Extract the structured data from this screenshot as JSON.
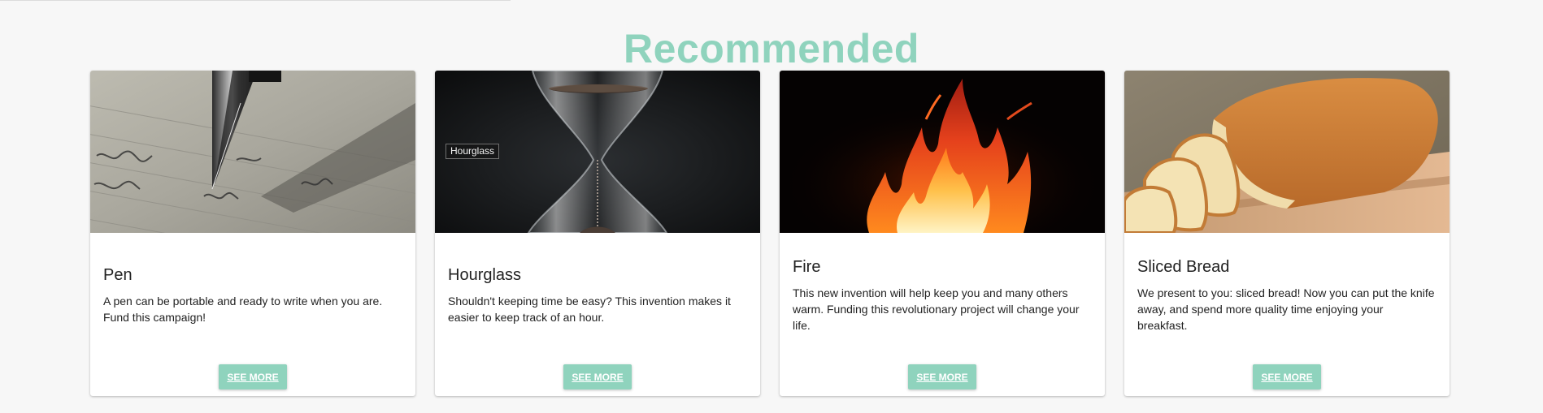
{
  "page": {
    "title": "Recommended",
    "accent_color": "#8fd3bd"
  },
  "cards": [
    {
      "title": "Pen",
      "description": "A pen can be portable and ready to write when you are. Fund this campaign!",
      "button_label": "SEE MORE",
      "image": "pen-writing-image"
    },
    {
      "title": "Hourglass",
      "description": "Shouldn't keeping time be easy? This invention makes it easier to keep track of an hour.",
      "button_label": "SEE MORE",
      "image": "hourglass-image",
      "image_label": "Hourglass"
    },
    {
      "title": "Fire",
      "description": "This new invention will help keep you and many others warm. Funding this revolutionary project will change your life.",
      "button_label": "SEE MORE",
      "image": "fire-image"
    },
    {
      "title": "Sliced Bread",
      "description": "We present to you: sliced bread! Now you can put the knife away, and spend more quality time enjoying your breakfast.",
      "button_label": "SEE MORE",
      "image": "sliced-bread-image"
    }
  ]
}
